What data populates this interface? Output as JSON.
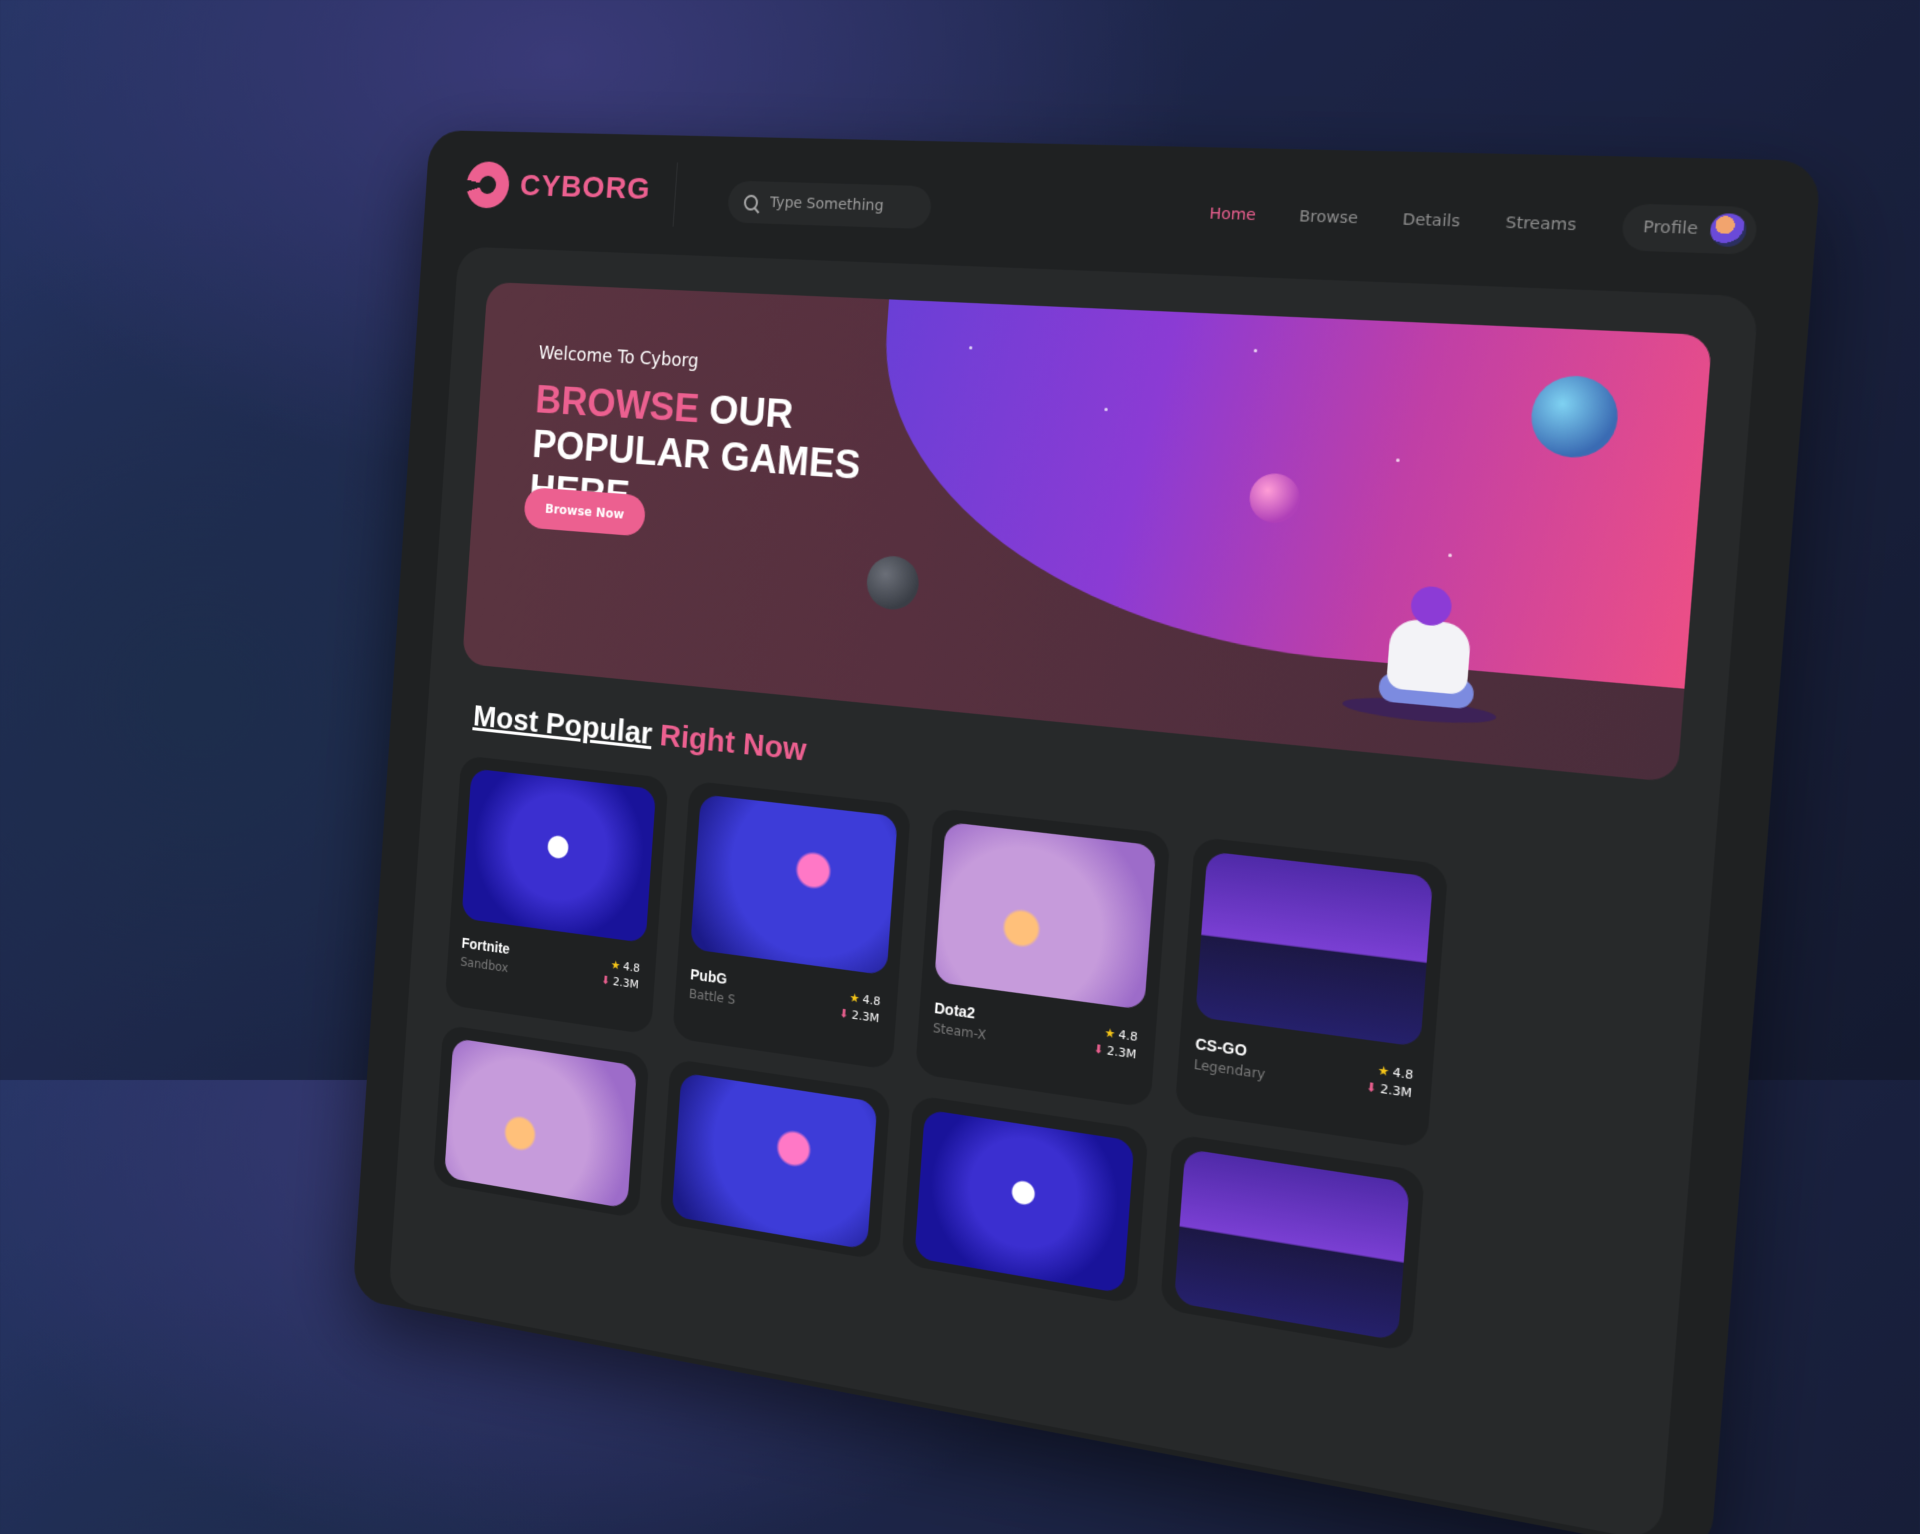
{
  "brand": {
    "name": "CYBORG",
    "accent": "#ec6090"
  },
  "search": {
    "placeholder": "Type Something"
  },
  "nav": {
    "items": [
      "Home",
      "Browse",
      "Details",
      "Streams"
    ],
    "active": "Home",
    "profile_label": "Profile"
  },
  "hero": {
    "welcome": "Welcome To Cyborg",
    "headline_accent": "BROWSE",
    "headline_rest": " OUR POPULAR GAMES HERE",
    "cta_label": "Browse Now"
  },
  "popular": {
    "title_part1": "Most Popular",
    "title_part2": "Right Now",
    "games": [
      {
        "name": "Fortnite",
        "genre": "Sandbox",
        "rating": "4.8",
        "downloads": "2.3M"
      },
      {
        "name": "PubG",
        "genre": "Battle S",
        "rating": "4.8",
        "downloads": "2.3M"
      },
      {
        "name": "Dota2",
        "genre": "Steam-X",
        "rating": "4.8",
        "downloads": "2.3M"
      },
      {
        "name": "CS-GO",
        "genre": "Legendary",
        "rating": "4.8",
        "downloads": "2.3M"
      }
    ]
  },
  "icons": {
    "search": "search-icon",
    "rating": "star-icon",
    "downloads": "download-icon"
  }
}
